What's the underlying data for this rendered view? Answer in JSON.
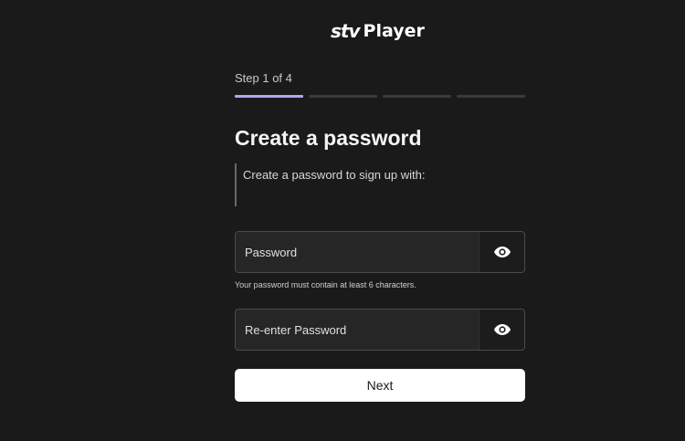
{
  "header": {
    "logo_stv": "stv",
    "logo_player": "Player"
  },
  "steps": {
    "label": "Step 1 of 4",
    "total": 4,
    "current": 1,
    "active_color": "#b6a4f0"
  },
  "form": {
    "title": "Create a password",
    "info_text": "Create a password to sign up with:",
    "password_placeholder": "Password",
    "password_value": "",
    "password_hint": "Your password must contain at least 6 characters.",
    "reenter_placeholder": "Re-enter Password",
    "reenter_value": "",
    "show_password_icon": "eye-icon",
    "next_label": "Next"
  }
}
